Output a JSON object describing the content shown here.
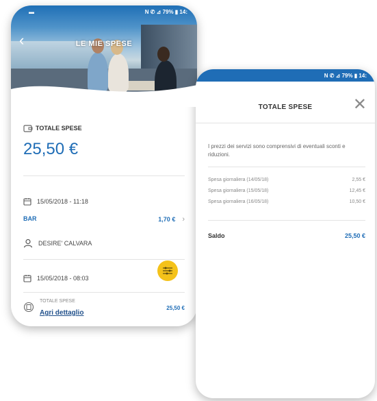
{
  "phone1": {
    "status_bar": "N ✆ ⊿ 79% ▮ 14:",
    "header_title": "LE MIE SPESE",
    "total_label": "TOTALE SPESE",
    "total_amount": "25,50 €",
    "entry1_datetime": "15/05/2018 - 11:18",
    "entry1_category": "BAR",
    "entry1_amount": "1,70 €",
    "entry1_person": "DESIRE' CALVARA",
    "entry2_datetime": "15/05/2018 - 08:03",
    "footer_label": "TOTALE SPESE",
    "footer_link": "Agri dettaglio",
    "footer_amount": "25,50 €"
  },
  "phone2": {
    "status_bar": "N ✆ ⊿ 79% ▮ 14:",
    "title": "TOTALE SPESE",
    "description": "I prezzi dei servizi sono comprensivi di eventuali sconti e riduzioni.",
    "lines": [
      {
        "label": "Spesa giornaliera (14/05/18)",
        "value": "2,55 €"
      },
      {
        "label": "Spesa giornaliera (15/05/18)",
        "value": "12,45 €"
      },
      {
        "label": "Spesa giornaliera (16/05/18)",
        "value": "10,50 €"
      }
    ],
    "saldo_label": "Saldo",
    "saldo_value": "25,50 €"
  },
  "colors": {
    "accent_blue": "#1f6db6",
    "fab_yellow": "#f4c21a",
    "link_blue": "#1f4f8a"
  },
  "icons": [
    "back-arrow-icon",
    "wallet-icon",
    "calendar-icon",
    "chevron-right-icon",
    "person-icon",
    "filter-icon",
    "receipt-icon",
    "close-icon"
  ]
}
